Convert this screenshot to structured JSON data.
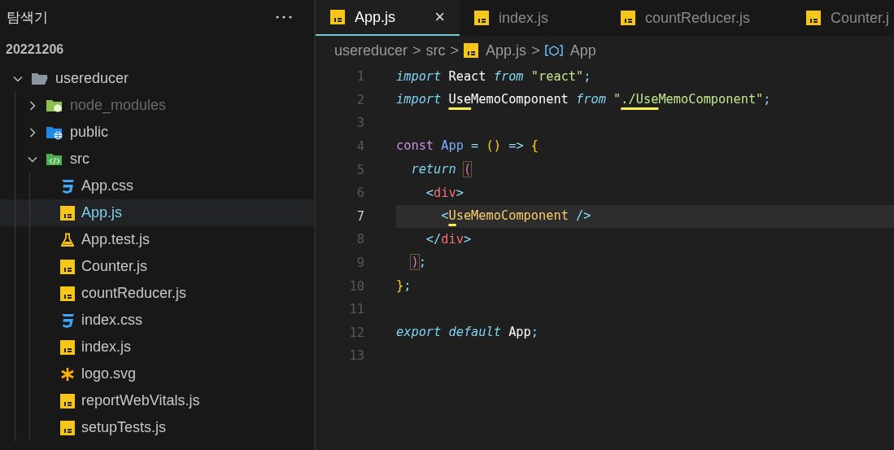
{
  "sidebar": {
    "title": "탐색기",
    "root": "20221206",
    "items": [
      {
        "label": "usereducer",
        "kind": "folder",
        "expanded": true,
        "selected": false,
        "dimmed": false,
        "children": [
          {
            "label": "node_modules",
            "kind": "node-folder",
            "expanded": false,
            "selected": false,
            "dimmed": true
          },
          {
            "label": "public",
            "kind": "public-folder",
            "expanded": false,
            "selected": false,
            "dimmed": false
          },
          {
            "label": "src",
            "kind": "src-folder",
            "expanded": true,
            "selected": false,
            "dimmed": false,
            "children": [
              {
                "label": "App.css",
                "kind": "css",
                "selected": false,
                "dimmed": false
              },
              {
                "label": "App.js",
                "kind": "js",
                "selected": true,
                "dimmed": false
              },
              {
                "label": "App.test.js",
                "kind": "test",
                "selected": false,
                "dimmed": false
              },
              {
                "label": "Counter.js",
                "kind": "js",
                "selected": false,
                "dimmed": false
              },
              {
                "label": "countReducer.js",
                "kind": "js",
                "selected": false,
                "dimmed": false
              },
              {
                "label": "index.css",
                "kind": "css",
                "selected": false,
                "dimmed": false
              },
              {
                "label": "index.js",
                "kind": "js",
                "selected": false,
                "dimmed": false
              },
              {
                "label": "logo.svg",
                "kind": "svg",
                "selected": false,
                "dimmed": false
              },
              {
                "label": "reportWebVitals.js",
                "kind": "js",
                "selected": false,
                "dimmed": false
              },
              {
                "label": "setupTests.js",
                "kind": "js",
                "selected": false,
                "dimmed": false
              }
            ]
          }
        ]
      }
    ]
  },
  "tabs": [
    {
      "label": "App.js",
      "kind": "js",
      "selected": true,
      "close": "×"
    },
    {
      "label": "index.js",
      "kind": "js",
      "selected": false
    },
    {
      "label": "countReducer.js",
      "kind": "js",
      "selected": false
    },
    {
      "label": "Counter.j",
      "kind": "js",
      "selected": false
    }
  ],
  "breadcrumb": [
    {
      "label": "usereducer",
      "kind": "plain",
      "separator": ">"
    },
    {
      "label": "src",
      "kind": "plain",
      "separator": ">"
    },
    {
      "label": "App.js",
      "kind": "js",
      "separator": ">"
    },
    {
      "label": "App",
      "kind": "symbol"
    }
  ],
  "code": {
    "lines": [
      {
        "number": "1",
        "current": false,
        "tokens": [
          {
            "t": "import ",
            "kind": "keyword",
            "squiggle": false
          },
          {
            "t": "React ",
            "kind": "ident",
            "squiggle": false
          },
          {
            "t": "from ",
            "kind": "keyword",
            "squiggle": false
          },
          {
            "t": "\"react\"",
            "kind": "string",
            "squiggle": false
          },
          {
            "t": ";",
            "kind": "punct",
            "squiggle": false
          }
        ]
      },
      {
        "number": "2",
        "current": false,
        "tokens": [
          {
            "t": "import ",
            "kind": "keyword",
            "squiggle": false
          },
          {
            "t": "Use",
            "kind": "ident",
            "squiggle": true
          },
          {
            "t": "MemoComponent ",
            "kind": "ident",
            "squiggle": false
          },
          {
            "t": "from ",
            "kind": "keyword",
            "squiggle": false
          },
          {
            "t": "\"",
            "kind": "string",
            "squiggle": false
          },
          {
            "t": "./Use",
            "kind": "string",
            "squiggle": true
          },
          {
            "t": "MemoComponent\"",
            "kind": "string",
            "squiggle": false
          },
          {
            "t": ";",
            "kind": "punct",
            "squiggle": false
          }
        ]
      },
      {
        "number": "3",
        "current": false
      },
      {
        "number": "4",
        "current": false,
        "tokens": [
          {
            "t": "const ",
            "kind": "storage",
            "squiggle": false
          },
          {
            "t": "App ",
            "kind": "func",
            "squiggle": false
          },
          {
            "t": "= ",
            "kind": "op",
            "squiggle": false
          },
          {
            "t": "() ",
            "kind": "paren",
            "squiggle": false
          },
          {
            "t": "=> ",
            "kind": "op",
            "squiggle": false
          },
          {
            "t": "{",
            "kind": "paren",
            "squiggle": false
          }
        ]
      },
      {
        "number": "5",
        "current": false,
        "tokens": [
          {
            "t": "  return ",
            "kind": "keyword",
            "squiggle": false
          },
          {
            "t": "(",
            "kind": "bracket-match",
            "squiggle": false
          }
        ]
      },
      {
        "number": "6",
        "current": false,
        "tokens": [
          {
            "t": "    <",
            "kind": "tag-punct",
            "squiggle": false
          },
          {
            "t": "div",
            "kind": "tag",
            "squiggle": false
          },
          {
            "t": ">",
            "kind": "tag-punct",
            "squiggle": false
          }
        ]
      },
      {
        "number": "7",
        "current": true,
        "tokens": [
          {
            "t": "      <",
            "kind": "tag-punct",
            "squiggle": false
          },
          {
            "t": "U",
            "kind": "component",
            "squiggle": true
          },
          {
            "t": "seMemoComponent ",
            "kind": "component",
            "squiggle": false
          },
          {
            "t": "/>",
            "kind": "tag-punct",
            "squiggle": false
          }
        ]
      },
      {
        "number": "8",
        "current": false,
        "tokens": [
          {
            "t": "    </",
            "kind": "tag-punct",
            "squiggle": false
          },
          {
            "t": "div",
            "kind": "tag",
            "squiggle": false
          },
          {
            "t": ">",
            "kind": "tag-punct",
            "squiggle": false
          }
        ]
      },
      {
        "number": "9",
        "current": false,
        "tokens": [
          {
            "t": "  )",
            "kind": "bracket-match",
            "squiggle": false
          },
          {
            "t": ";",
            "kind": "punct",
            "squiggle": false
          }
        ]
      },
      {
        "number": "10",
        "current": false,
        "tokens": [
          {
            "t": "}",
            "kind": "paren",
            "squiggle": false
          },
          {
            "t": ";",
            "kind": "punct",
            "squiggle": false
          }
        ]
      },
      {
        "number": "11",
        "current": false
      },
      {
        "number": "12",
        "current": false,
        "tokens": [
          {
            "t": "export default ",
            "kind": "keyword",
            "squiggle": false
          },
          {
            "t": "App",
            "kind": "ident",
            "squiggle": false
          },
          {
            "t": ";",
            "kind": "punct",
            "squiggle": false
          }
        ]
      },
      {
        "number": "13",
        "current": false
      }
    ]
  }
}
